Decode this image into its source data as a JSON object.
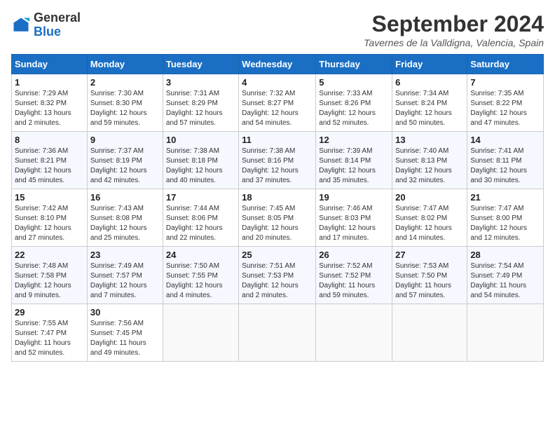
{
  "logo": {
    "general": "General",
    "blue": "Blue"
  },
  "title": "September 2024",
  "location": "Tavernes de la Valldigna, Valencia, Spain",
  "days_header": [
    "Sunday",
    "Monday",
    "Tuesday",
    "Wednesday",
    "Thursday",
    "Friday",
    "Saturday"
  ],
  "weeks": [
    [
      {
        "day": "1",
        "info": "Sunrise: 7:29 AM\nSunset: 8:32 PM\nDaylight: 13 hours\nand 2 minutes."
      },
      {
        "day": "2",
        "info": "Sunrise: 7:30 AM\nSunset: 8:30 PM\nDaylight: 12 hours\nand 59 minutes."
      },
      {
        "day": "3",
        "info": "Sunrise: 7:31 AM\nSunset: 8:29 PM\nDaylight: 12 hours\nand 57 minutes."
      },
      {
        "day": "4",
        "info": "Sunrise: 7:32 AM\nSunset: 8:27 PM\nDaylight: 12 hours\nand 54 minutes."
      },
      {
        "day": "5",
        "info": "Sunrise: 7:33 AM\nSunset: 8:26 PM\nDaylight: 12 hours\nand 52 minutes."
      },
      {
        "day": "6",
        "info": "Sunrise: 7:34 AM\nSunset: 8:24 PM\nDaylight: 12 hours\nand 50 minutes."
      },
      {
        "day": "7",
        "info": "Sunrise: 7:35 AM\nSunset: 8:22 PM\nDaylight: 12 hours\nand 47 minutes."
      }
    ],
    [
      {
        "day": "8",
        "info": "Sunrise: 7:36 AM\nSunset: 8:21 PM\nDaylight: 12 hours\nand 45 minutes."
      },
      {
        "day": "9",
        "info": "Sunrise: 7:37 AM\nSunset: 8:19 PM\nDaylight: 12 hours\nand 42 minutes."
      },
      {
        "day": "10",
        "info": "Sunrise: 7:38 AM\nSunset: 8:18 PM\nDaylight: 12 hours\nand 40 minutes."
      },
      {
        "day": "11",
        "info": "Sunrise: 7:38 AM\nSunset: 8:16 PM\nDaylight: 12 hours\nand 37 minutes."
      },
      {
        "day": "12",
        "info": "Sunrise: 7:39 AM\nSunset: 8:14 PM\nDaylight: 12 hours\nand 35 minutes."
      },
      {
        "day": "13",
        "info": "Sunrise: 7:40 AM\nSunset: 8:13 PM\nDaylight: 12 hours\nand 32 minutes."
      },
      {
        "day": "14",
        "info": "Sunrise: 7:41 AM\nSunset: 8:11 PM\nDaylight: 12 hours\nand 30 minutes."
      }
    ],
    [
      {
        "day": "15",
        "info": "Sunrise: 7:42 AM\nSunset: 8:10 PM\nDaylight: 12 hours\nand 27 minutes."
      },
      {
        "day": "16",
        "info": "Sunrise: 7:43 AM\nSunset: 8:08 PM\nDaylight: 12 hours\nand 25 minutes."
      },
      {
        "day": "17",
        "info": "Sunrise: 7:44 AM\nSunset: 8:06 PM\nDaylight: 12 hours\nand 22 minutes."
      },
      {
        "day": "18",
        "info": "Sunrise: 7:45 AM\nSunset: 8:05 PM\nDaylight: 12 hours\nand 20 minutes."
      },
      {
        "day": "19",
        "info": "Sunrise: 7:46 AM\nSunset: 8:03 PM\nDaylight: 12 hours\nand 17 minutes."
      },
      {
        "day": "20",
        "info": "Sunrise: 7:47 AM\nSunset: 8:02 PM\nDaylight: 12 hours\nand 14 minutes."
      },
      {
        "day": "21",
        "info": "Sunrise: 7:47 AM\nSunset: 8:00 PM\nDaylight: 12 hours\nand 12 minutes."
      }
    ],
    [
      {
        "day": "22",
        "info": "Sunrise: 7:48 AM\nSunset: 7:58 PM\nDaylight: 12 hours\nand 9 minutes."
      },
      {
        "day": "23",
        "info": "Sunrise: 7:49 AM\nSunset: 7:57 PM\nDaylight: 12 hours\nand 7 minutes."
      },
      {
        "day": "24",
        "info": "Sunrise: 7:50 AM\nSunset: 7:55 PM\nDaylight: 12 hours\nand 4 minutes."
      },
      {
        "day": "25",
        "info": "Sunrise: 7:51 AM\nSunset: 7:53 PM\nDaylight: 12 hours\nand 2 minutes."
      },
      {
        "day": "26",
        "info": "Sunrise: 7:52 AM\nSunset: 7:52 PM\nDaylight: 11 hours\nand 59 minutes."
      },
      {
        "day": "27",
        "info": "Sunrise: 7:53 AM\nSunset: 7:50 PM\nDaylight: 11 hours\nand 57 minutes."
      },
      {
        "day": "28",
        "info": "Sunrise: 7:54 AM\nSunset: 7:49 PM\nDaylight: 11 hours\nand 54 minutes."
      }
    ],
    [
      {
        "day": "29",
        "info": "Sunrise: 7:55 AM\nSunset: 7:47 PM\nDaylight: 11 hours\nand 52 minutes."
      },
      {
        "day": "30",
        "info": "Sunrise: 7:56 AM\nSunset: 7:45 PM\nDaylight: 11 hours\nand 49 minutes."
      },
      null,
      null,
      null,
      null,
      null
    ]
  ]
}
